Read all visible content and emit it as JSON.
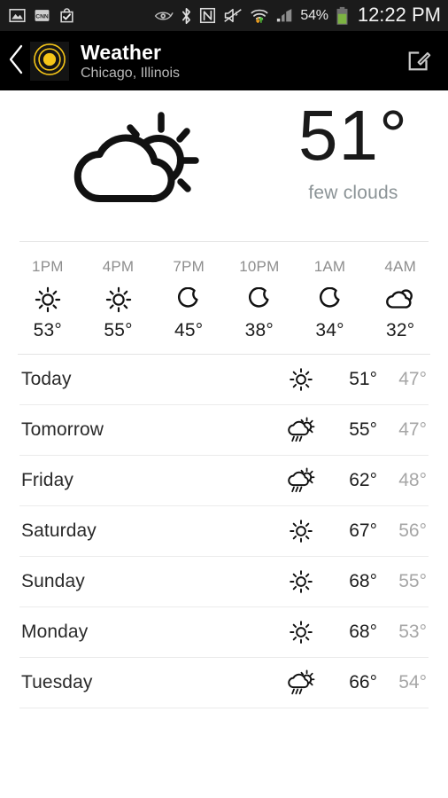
{
  "statusbar": {
    "icons_left": [
      "gallery-icon",
      "cnn-icon",
      "play-store-bag-icon"
    ],
    "icons_right": [
      "smart-stay-eye-icon",
      "bluetooth-icon",
      "nfc-icon",
      "sound-muted-icon",
      "wifi-transfer-icon",
      "cell-signal-icon"
    ],
    "battery_percent": "54%",
    "battery_color": "#7cb342",
    "clock": "12:22 PM"
  },
  "actionbar": {
    "back_icon": "back-chevron-icon",
    "logo_icon": "weather-app-logo-icon",
    "logo_color": "#f5c518",
    "title": "Weather",
    "subtitle": "Chicago, Illinois",
    "edit_icon": "edit-compose-icon"
  },
  "current": {
    "icon": "few-clouds-icon",
    "temperature": "51°",
    "description": "few clouds"
  },
  "hourly": [
    {
      "time": "1PM",
      "icon": "sun-icon",
      "temp": "53°"
    },
    {
      "time": "4PM",
      "icon": "sun-icon",
      "temp": "55°"
    },
    {
      "time": "7PM",
      "icon": "moon-icon",
      "temp": "45°"
    },
    {
      "time": "10PM",
      "icon": "moon-icon",
      "temp": "38°"
    },
    {
      "time": "1AM",
      "icon": "moon-icon",
      "temp": "34°"
    },
    {
      "time": "4AM",
      "icon": "cloud-icon",
      "temp": "32°"
    }
  ],
  "daily": [
    {
      "day": "Today",
      "icon": "sun-icon",
      "high": "51°",
      "low": "47°"
    },
    {
      "day": "Tomorrow",
      "icon": "rain-sun-icon",
      "high": "55°",
      "low": "47°"
    },
    {
      "day": "Friday",
      "icon": "rain-sun-icon",
      "high": "62°",
      "low": "48°"
    },
    {
      "day": "Saturday",
      "icon": "sun-icon",
      "high": "67°",
      "low": "56°"
    },
    {
      "day": "Sunday",
      "icon": "sun-icon",
      "high": "68°",
      "low": "55°"
    },
    {
      "day": "Monday",
      "icon": "sun-icon",
      "high": "68°",
      "low": "53°"
    },
    {
      "day": "Tuesday",
      "icon": "rain-sun-icon",
      "high": "66°",
      "low": "54°"
    }
  ],
  "colors": {
    "statusbar_bg": "#1b1b1b",
    "actionbar_bg": "#000000",
    "page_bg": "#ffffff",
    "muted_text": "#8e8e8e",
    "accent": "#f5c518"
  }
}
